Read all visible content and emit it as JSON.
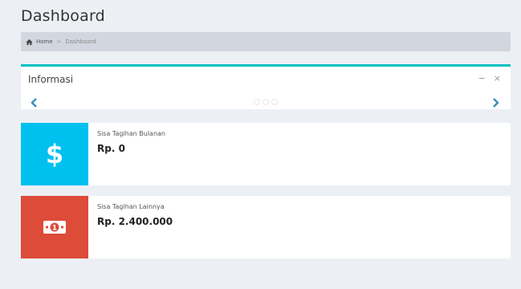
{
  "page": {
    "title": "Dashboard"
  },
  "breadcrumb": {
    "home_icon": "home-icon",
    "home": "Home",
    "separator": ">",
    "current": "Dashboard"
  },
  "info_panel": {
    "title": "Informasi",
    "collapse_symbol": "−",
    "close_symbol": "×",
    "icons": {
      "prev": "chevron-left-icon",
      "next": "chevron-right-icon"
    },
    "accent_color": "#00c0c0"
  },
  "cards": [
    {
      "label": "Sisa Tagihan Bulanan",
      "value": "Rp. 0",
      "icon": "dollar-icon",
      "color": "#00c0ef",
      "icon_glyph": "$"
    },
    {
      "label": "Sisa Tagihan Lainnya",
      "value": "Rp. 2.400.000",
      "icon": "money-bill-icon",
      "color": "#dd4b39"
    }
  ]
}
